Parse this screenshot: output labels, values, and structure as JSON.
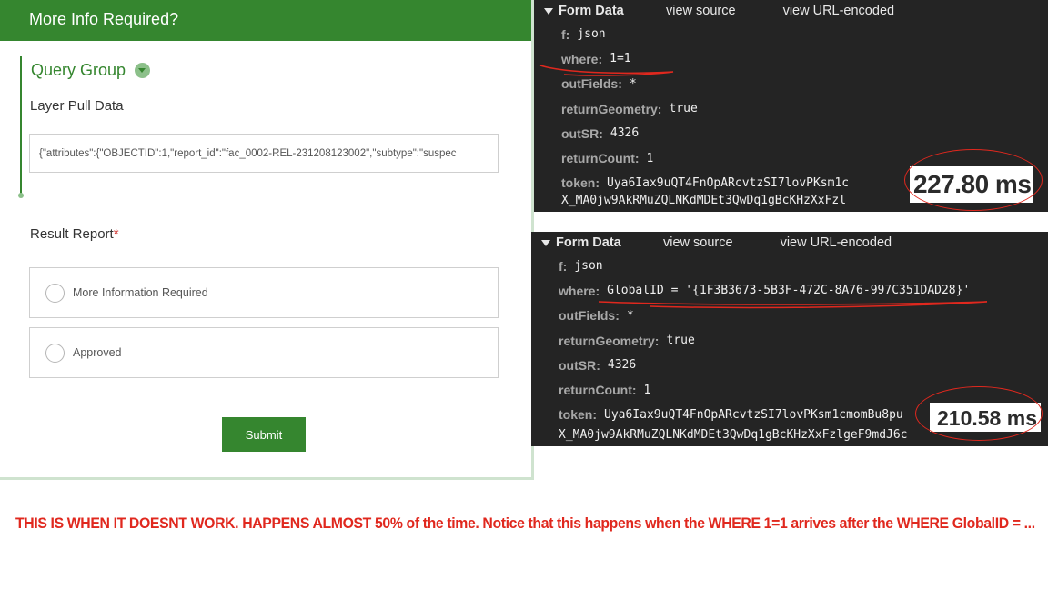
{
  "form": {
    "header_title": "More Info Required?",
    "group_title": "Query Group",
    "layer_label": "Layer Pull Data",
    "layer_value": "{\"attributes\":{\"OBJECTID\":1,\"report_id\":\"fac_0002-REL-231208123002\",\"subtype\":\"suspec",
    "result_label": "Result Report",
    "required_mark": "*",
    "options": [
      "More Information Required",
      "Approved"
    ],
    "submit_label": "Submit"
  },
  "devtools_top": {
    "title": "Form Data",
    "view_source": "view source",
    "view_url_encoded": "view URL-encoded",
    "rows": [
      {
        "key": "f:",
        "value": "json"
      },
      {
        "key": "where:",
        "value": "1=1"
      },
      {
        "key": "outFields:",
        "value": "*"
      },
      {
        "key": "returnGeometry:",
        "value": "true"
      },
      {
        "key": "outSR:",
        "value": "4326"
      },
      {
        "key": "returnCount:",
        "value": "1"
      },
      {
        "key": "token:",
        "value": "Uya6Iax9uQT4FnOpARcvtzSI7lovPKsm1c"
      }
    ],
    "cut_line": "X_MA0jw9AkRMuZQLNKdMDEt3QwDq1gBcKHzXxFzl",
    "timing": "227.80 ms"
  },
  "devtools_bottom": {
    "title": "Form Data",
    "view_source": "view source",
    "view_url_encoded": "view URL-encoded",
    "rows": [
      {
        "key": "f:",
        "value": "json"
      },
      {
        "key": "where:",
        "value": "GlobalID = '{1F3B3673-5B3F-472C-8A76-997C351DAD28}'"
      },
      {
        "key": "outFields:",
        "value": "*"
      },
      {
        "key": "returnGeometry:",
        "value": "true"
      },
      {
        "key": "outSR:",
        "value": "4326"
      },
      {
        "key": "returnCount:",
        "value": "1"
      },
      {
        "key": "token:",
        "value": "Uya6Iax9uQT4FnOpARcvtzSI7lovPKsm1cmomBu8pu"
      }
    ],
    "cut_line": "X_MA0jw9AkRMuZQLNKdMDEt3QwDq1gBcKHzXxFzlgeF9mdJ6c",
    "timing": "210.58 ms"
  },
  "caption": "THIS IS WHEN IT DOESNT WORK. HAPPENS ALMOST 50% of the time. Notice that this happens when the WHERE 1=1 arrives after the WHERE GlobalID = ...",
  "colors": {
    "brand_green": "#35862f",
    "annotation_red": "#e0281e",
    "devtools_bg": "#242424"
  }
}
